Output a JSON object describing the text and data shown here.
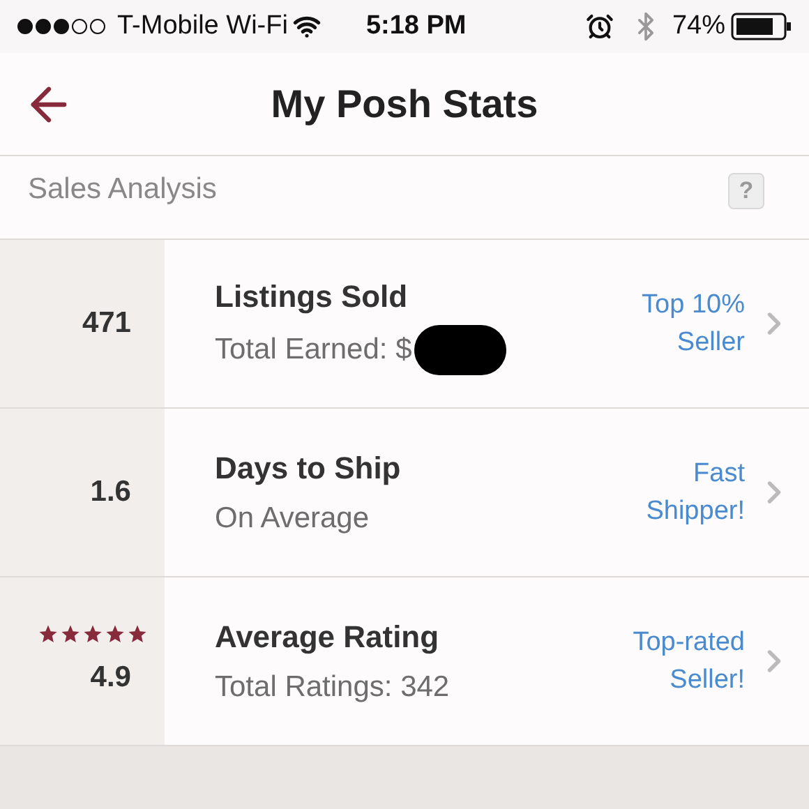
{
  "status_bar": {
    "carrier": "T-Mobile Wi-Fi",
    "time": "5:18 PM",
    "battery": "74%"
  },
  "nav": {
    "title": "My Posh Stats"
  },
  "section": {
    "title": "Sales Analysis",
    "help": "?"
  },
  "stats": [
    {
      "kind": "number",
      "value": "471",
      "title": "Listings Sold",
      "subtitle": "Total Earned: $",
      "redacted": true,
      "badge": [
        "Top 10%",
        "Seller"
      ]
    },
    {
      "kind": "number",
      "value": "1.6",
      "title": "Days to Ship",
      "subtitle": "On Average",
      "redacted": false,
      "badge": [
        "Fast",
        "Shipper!"
      ]
    },
    {
      "kind": "rating",
      "stars": 5,
      "value": "4.9",
      "title": "Average Rating",
      "subtitle": "Total Ratings: 342",
      "redacted": false,
      "badge": [
        "Top-rated",
        "Seller!"
      ]
    }
  ]
}
